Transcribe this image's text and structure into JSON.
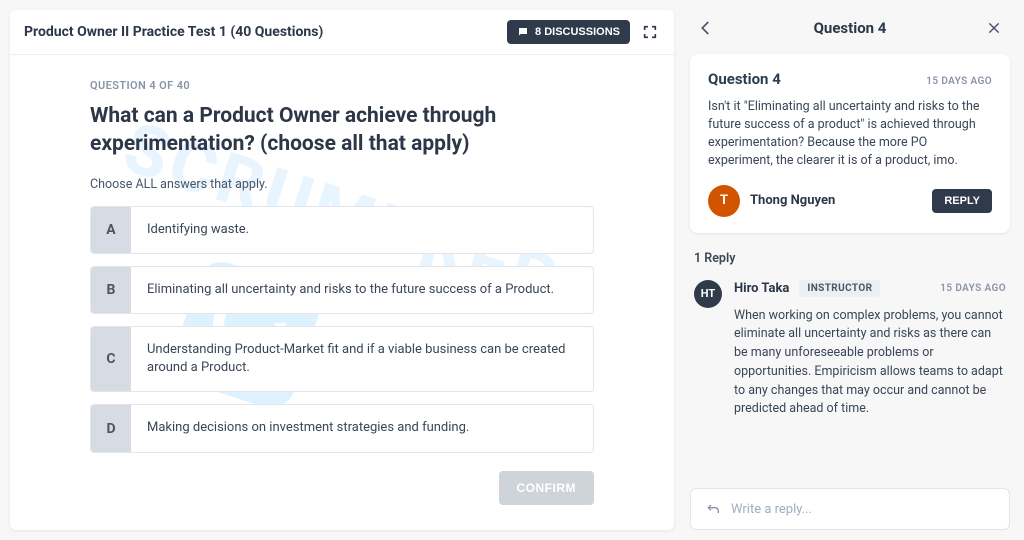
{
  "test": {
    "title": "Product Owner II Practice Test 1 (40 Questions)",
    "discussions_label": "8 DISCUSSIONS",
    "kicker": "QUESTION 4 OF 40",
    "question": "What can a Product Owner achieve through experimentation? (choose all that apply)",
    "instruction": "Choose ALL answers that apply.",
    "choices": [
      {
        "letter": "A",
        "text": "Identifying waste."
      },
      {
        "letter": "B",
        "text": "Eliminating all uncertainty and risks to the future success of a Product."
      },
      {
        "letter": "C",
        "text": "Understanding Product-Market fit and if a viable business can be created around a Product."
      },
      {
        "letter": "D",
        "text": "Making decisions on investment strategies and funding."
      }
    ],
    "confirm_label": "CONFIRM"
  },
  "panel": {
    "title": "Question 4",
    "thread": {
      "title": "Question 4",
      "age": "15 DAYS AGO",
      "body": "Isn't it \"Eliminating all uncertainty and risks to the future success of a product\" is achieved through experimentation? Because the more PO experiment, the clearer it is of a product, imo.",
      "author_initial": "T",
      "author_name": "Thong Nguyen",
      "reply_label": "REPLY"
    },
    "reply_count_label": "1 Reply",
    "reply": {
      "author_initial": "HT",
      "author_name": "Hiro Taka",
      "badge": "INSTRUCTOR",
      "age": "15 DAYS AGO",
      "body": "When working on complex problems, you cannot eliminate all uncertainty and risks as there can be many unforeseeable problems or opportunities. Empiricism allows teams to adapt to any changes that may occur and cannot be predicted ahead of time."
    },
    "reply_placeholder": "Write a reply..."
  },
  "watermark": "SCRUMPREP"
}
